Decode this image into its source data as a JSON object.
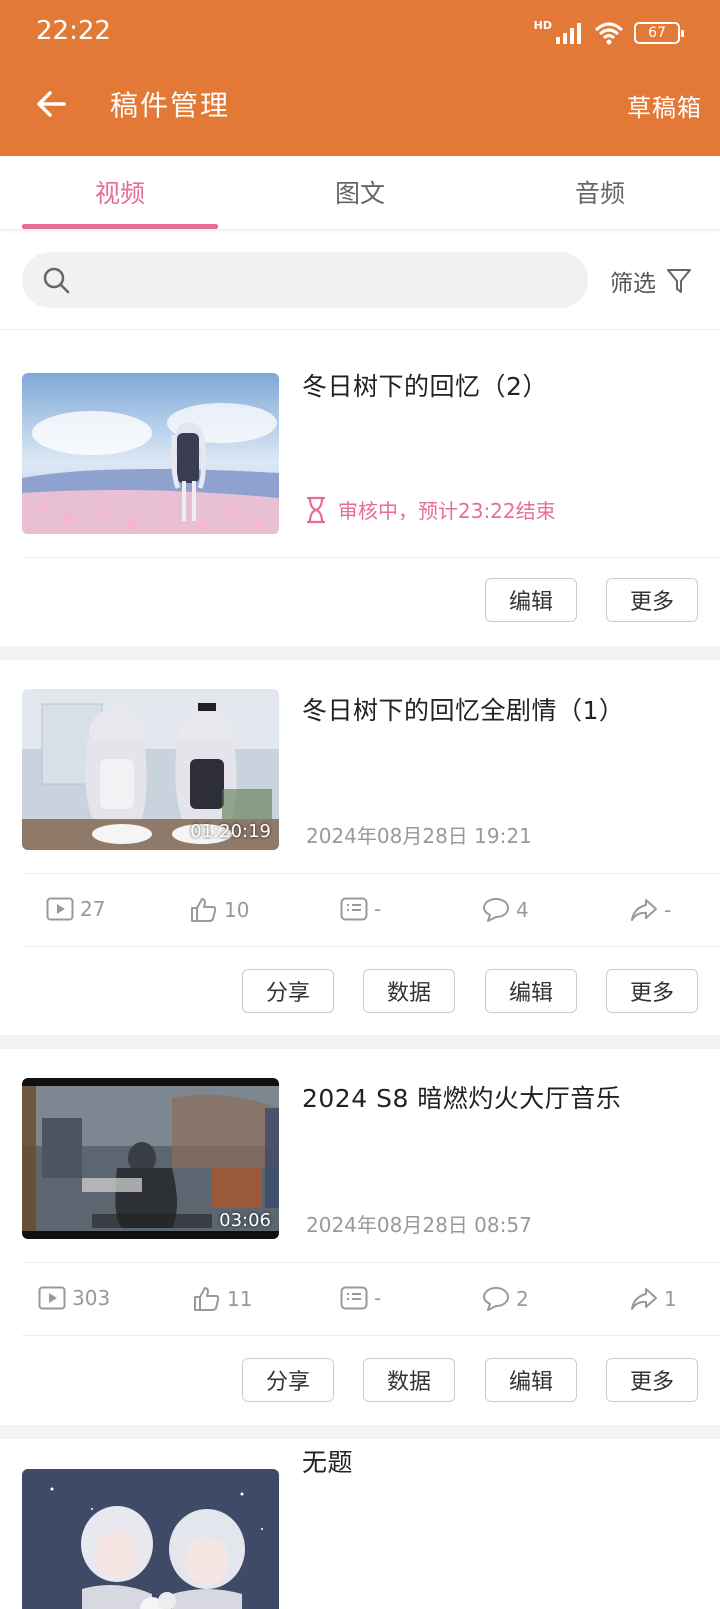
{
  "status_bar": {
    "time": "22:22",
    "battery": "67",
    "network": "HD"
  },
  "app_bar": {
    "title": "稿件管理",
    "drafts_label": "草稿箱"
  },
  "tabs": [
    {
      "label": "视频",
      "active": true
    },
    {
      "label": "图文",
      "active": false
    },
    {
      "label": "音频",
      "active": false
    }
  ],
  "search": {
    "placeholder": "",
    "filter_label": "筛选"
  },
  "buttons": {
    "share": "分享",
    "data": "数据",
    "edit": "编辑",
    "more": "更多"
  },
  "videos": [
    {
      "title": "冬日树下的回忆（2）",
      "review_status": "审核中，预计23:22结束"
    },
    {
      "title": "冬日树下的回忆全剧情（1）",
      "duration": "01:20:19",
      "date": "2024年08月28日 19:21",
      "stats": {
        "plays": "27",
        "likes": "10",
        "danmaku": "-",
        "comments": "4",
        "shares": "-"
      }
    },
    {
      "title": "2024 S8 暗燃灼火大厅音乐",
      "duration": "03:06",
      "date": "2024年08月28日 08:57",
      "stats": {
        "plays": "303",
        "likes": "11",
        "danmaku": "-",
        "comments": "2",
        "shares": "1"
      }
    },
    {
      "title": "无题"
    }
  ],
  "colors": {
    "header": "#E37936",
    "accent": "#E86D97"
  }
}
